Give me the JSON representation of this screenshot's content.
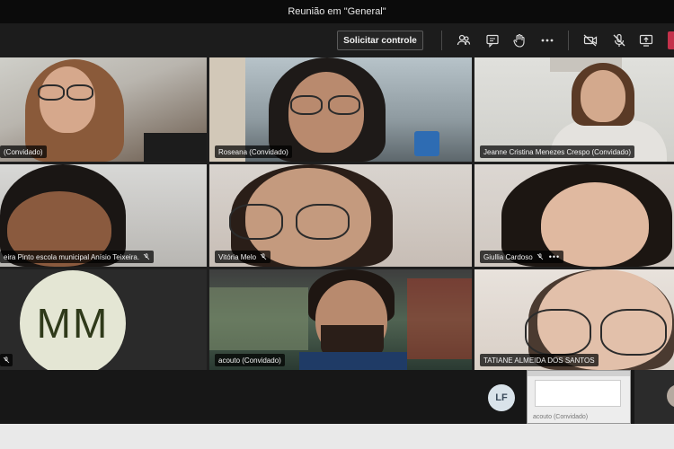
{
  "window": {
    "title": "Reunião em \"General\""
  },
  "toolbar": {
    "request_control_label": "Solicitar controle",
    "icons": [
      "participants-icon",
      "chat-icon",
      "raise-hand-icon",
      "more-options-icon",
      "camera-off-icon",
      "mic-off-icon",
      "share-screen-icon",
      "hang-up-icon"
    ]
  },
  "tiles": [
    {
      "name": "(Convidado)"
    },
    {
      "name": "Roseana (Convidado)"
    },
    {
      "name": "Jeanne Cristina Menezes Crespo (Convidado)"
    },
    {
      "name": "eira Pinto escola municipal Anísio Teixeira."
    },
    {
      "name": "Vitória Melo"
    },
    {
      "name": "Giullia Cardoso",
      "more": "•••"
    },
    {
      "name": "",
      "initials": "MM"
    },
    {
      "name": "acouto (Convidado)"
    },
    {
      "name": "TATIANE ALMEIDA DOS SANTOS"
    }
  ],
  "bottom": {
    "lf_initials": "LF",
    "share_label": "acouto (Convidado)"
  },
  "colors": {
    "hangup": "#c4314b",
    "avatar_mm_bg": "#e4e6d4",
    "avatar_lf_bg": "#d9e3ea"
  }
}
